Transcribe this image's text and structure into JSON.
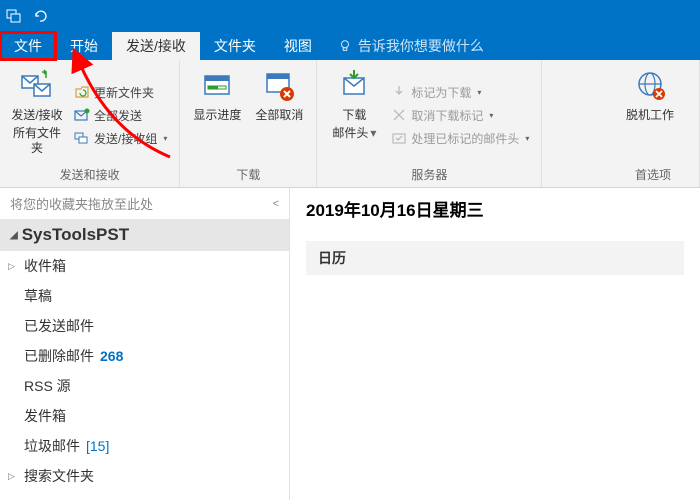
{
  "titlebar": {
    "icon": "window-icon",
    "undo": "undo-icon"
  },
  "tabs": {
    "file": "文件",
    "home": "开始",
    "sendreceive": "发送/接收",
    "folder": "文件夹",
    "view": "视图",
    "tellme": "告诉我你想要做什么"
  },
  "ribbon": {
    "g1": {
      "btn_lines": {
        "l1": "发送/接收",
        "l2": "所有文件夹"
      },
      "update": "更新文件夹",
      "sendall": "全部发送",
      "srgroups": "发送/接收组",
      "label": "发送和接收"
    },
    "g2": {
      "progress": "显示进度",
      "cancel": "全部取消",
      "label": "下载"
    },
    "g3": {
      "headers": {
        "l1": "下载",
        "l2": "邮件头"
      },
      "mark": "标记为下载",
      "unmark": "取消下载标记",
      "process": "处理已标记的邮件头",
      "label": "服务器"
    },
    "g4": {
      "offline": "脱机工作",
      "label": "首选项"
    }
  },
  "nav": {
    "fav_hint": "将您的收藏夹拖放至此处",
    "account": "SysToolsPST",
    "folders": {
      "inbox": "收件箱",
      "drafts": "草稿",
      "sent": "已发送邮件",
      "deleted": "已删除邮件",
      "deleted_count": "268",
      "rss": "RSS 源",
      "outbox": "发件箱",
      "junk": "垃圾邮件",
      "junk_count": "[15]",
      "search": "搜索文件夹"
    }
  },
  "main": {
    "date": "2019年10月16日星期三",
    "calendar": "日历"
  }
}
